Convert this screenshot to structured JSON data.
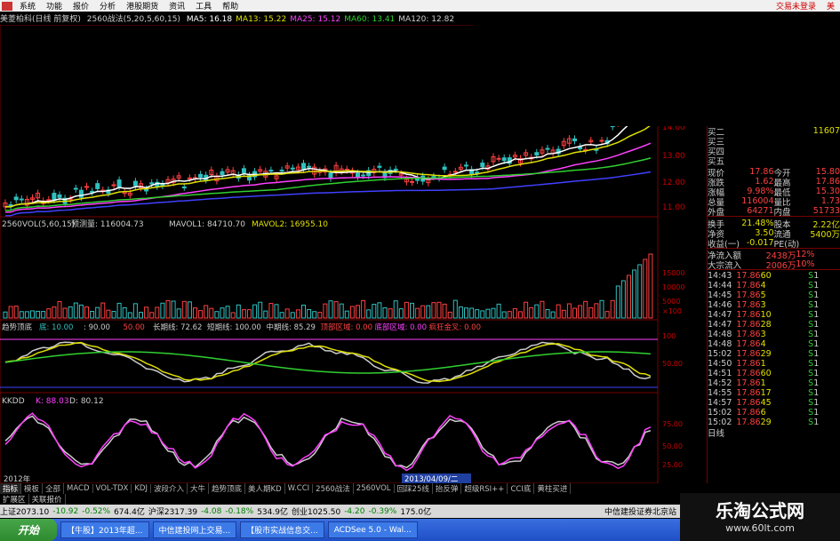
{
  "menu": {
    "items": [
      "系统",
      "功能",
      "报价",
      "分析",
      "港股期货",
      "资讯",
      "工具",
      "帮助"
    ],
    "right": [
      "交易未登录",
      "美"
    ]
  },
  "info": {
    "stock": "美菱柏科(日线 前复权)",
    "indicator": "2560战法(5,20,5,60,15)",
    "ma": [
      {
        "label": "MA5: 16.18",
        "color": "#ffffff"
      },
      {
        "label": "MA13: 15.22",
        "color": "#e0e000"
      },
      {
        "label": "MA25: 15.12",
        "color": "#ff40ff"
      },
      {
        "label": "MA60: 13.41",
        "color": "#30d030"
      },
      {
        "label": "MA120: 12.82",
        "color": "#cccccc"
      }
    ]
  },
  "vol": {
    "title": "2560VOL(5,60,15)",
    "pred": "预测量: 116004.73",
    "mavol1": "MAVOL1: 84710.70",
    "mavol2": "MAVOL2: 16955.10",
    "ticks": [
      "15000",
      "10000",
      "5000",
      "×100"
    ]
  },
  "trend": {
    "title": "趋势顶底",
    "items": [
      "底: 10.00",
      ": 90.00",
      "50.00",
      "长期线: 72.62",
      "短期线: 100.00",
      "中期线: 85.29",
      "顶部区域: 0.00",
      "底部区域: 0.00",
      "疯狂金叉: 0.00"
    ],
    "ticks": [
      "100",
      "50.00"
    ]
  },
  "kdj": {
    "title": "KKDD",
    "k": "K: 88.03",
    "d": "D: 80.12",
    "ticks": [
      "75.00",
      "50.00",
      "25.00"
    ]
  },
  "price_ticks": [
    "14.00",
    "13.00",
    "12.00",
    "11.00"
  ],
  "date_label": "2013/04/09/二",
  "quote": {
    "bid": [
      {
        "l": "买二",
        "v": "11607"
      },
      {
        "l": "买三",
        "v": ""
      },
      {
        "l": "买四",
        "v": ""
      },
      {
        "l": "买五",
        "v": ""
      }
    ],
    "stats": [
      [
        "现价",
        "17.86",
        "今开",
        "15.80"
      ],
      [
        "涨跌",
        "1.62",
        "最高",
        "17.86"
      ],
      [
        "涨幅",
        "9.98%",
        "最低",
        "15.30"
      ],
      [
        "总量",
        "116004",
        "量比",
        "1.73"
      ],
      [
        "外盘",
        "64271",
        "内盘",
        "51733"
      ]
    ],
    "stats2": [
      [
        "换手",
        "21.48%",
        "股本",
        "2.22亿"
      ],
      [
        "净资",
        "3.50",
        "流通",
        "5400万"
      ],
      [
        "收益(一)",
        "-0.017",
        "PE(动)",
        ""
      ]
    ],
    "flow": [
      [
        "净流入额",
        "2438万",
        "12%"
      ],
      [
        "大宗流入",
        "2006万",
        "10%"
      ]
    ],
    "ticks": [
      [
        "14:43",
        "17.86",
        "60",
        "S",
        "1"
      ],
      [
        "14:44",
        "17.86",
        "4",
        "S",
        "1"
      ],
      [
        "14:45",
        "17.86",
        "5",
        "S",
        "1"
      ],
      [
        "14:46",
        "17.86",
        "3",
        "S",
        "1"
      ],
      [
        "14:47",
        "17.86",
        "10",
        "S",
        "1"
      ],
      [
        "14:47",
        "17.86",
        "28",
        "S",
        "1"
      ],
      [
        "14:48",
        "17.86",
        "3",
        "S",
        "1"
      ],
      [
        "14:48",
        "17.86",
        "4",
        "S",
        "1"
      ],
      [
        "15:02",
        "17.86",
        "29",
        "S",
        "1"
      ],
      [
        "14:50",
        "17.86",
        "1",
        "S",
        "1"
      ],
      [
        "14:51",
        "17.86",
        "60",
        "S",
        "1"
      ],
      [
        "14:52",
        "17.86",
        "1",
        "S",
        "1"
      ],
      [
        "14:55",
        "17.86",
        "17",
        "S",
        "1"
      ],
      [
        "14:57",
        "17.86",
        "45",
        "S",
        "1"
      ],
      [
        "15:02",
        "17.86",
        "6",
        "S",
        "1"
      ],
      [
        "15:02",
        "17.86",
        "29",
        "S",
        "1"
      ]
    ],
    "tail": "日线"
  },
  "tabs": [
    "指标",
    "模板",
    "全部",
    "MACD",
    "VOL-TDX",
    "KDJ",
    "波段介入",
    "大牛",
    "趋势顶底",
    "美人期KD",
    "W.CCI",
    "2560战法",
    "2560VOL",
    "回踩25线",
    "抬反弹",
    "超级RSI++",
    "CCI底",
    "黄柱买进"
  ],
  "tabs2": [
    "扩展区",
    "关联报价"
  ],
  "status": {
    "items": [
      "上证2073.10",
      "-10.92",
      "-0.52%",
      "674.4亿",
      "沪深2317.39",
      "-4.08",
      "-0.18%",
      "534.9亿",
      "创业1025.50",
      "-4.20",
      "-0.39%",
      "175.0亿"
    ],
    "broker": "中信建投证券北京站"
  },
  "taskbar": {
    "start": "开始",
    "items": [
      "【牛股】2013年超...",
      "中信建投网上交易...",
      "【股市实战信息交...",
      "ACDSee 5.0 - Wal..."
    ]
  },
  "watermark": {
    "line1": "乐淘公式网",
    "line2": "www.60lt.com"
  },
  "left_date": "2012年"
}
